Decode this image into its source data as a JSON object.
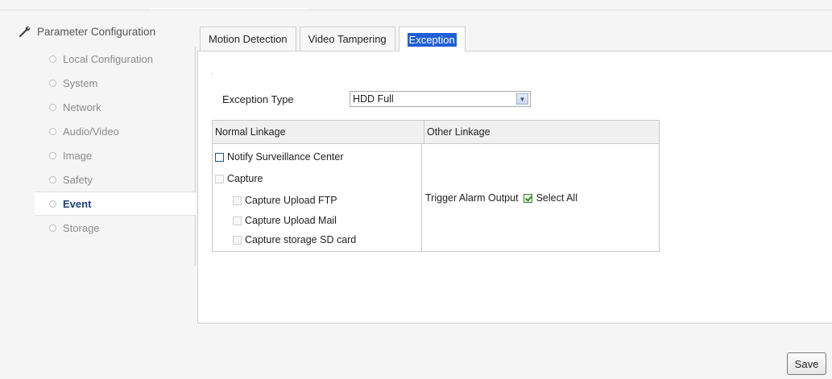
{
  "sidebar": {
    "title": "Parameter Configuration",
    "title_icon": "wrench-icon",
    "items": [
      {
        "label": "Local Configuration"
      },
      {
        "label": "System"
      },
      {
        "label": "Network"
      },
      {
        "label": "Audio/Video"
      },
      {
        "label": "Image"
      },
      {
        "label": "Safety"
      },
      {
        "label": "Event"
      },
      {
        "label": "Storage"
      }
    ],
    "active": "Event"
  },
  "tabs": [
    {
      "label": "Motion Detection"
    },
    {
      "label": "Video Tampering"
    },
    {
      "label": "Exception"
    }
  ],
  "active_tab": "Exception",
  "exception": {
    "label": "Exception Type",
    "value": "HDD Full"
  },
  "linkage": {
    "normal_header": "Normal Linkage",
    "other_header": "Other Linkage",
    "normal": [
      {
        "label": "Notify Surveillance Center",
        "checked": false,
        "enabled": true
      },
      {
        "label": "Capture",
        "checked": false,
        "enabled": false
      },
      {
        "label": "Capture Upload FTP",
        "checked": false,
        "enabled": false
      },
      {
        "label": "Capture Upload Mail",
        "checked": false,
        "enabled": false
      },
      {
        "label": "Capture storage SD card",
        "checked": false,
        "enabled": false
      }
    ],
    "trigger_label": "Trigger Alarm Output",
    "select_all_label": "Select All",
    "select_all_checked": true
  },
  "save_label": "Save",
  "colors": {
    "accent": "#1f5ed6",
    "active_menu": "#1f3f7a"
  }
}
